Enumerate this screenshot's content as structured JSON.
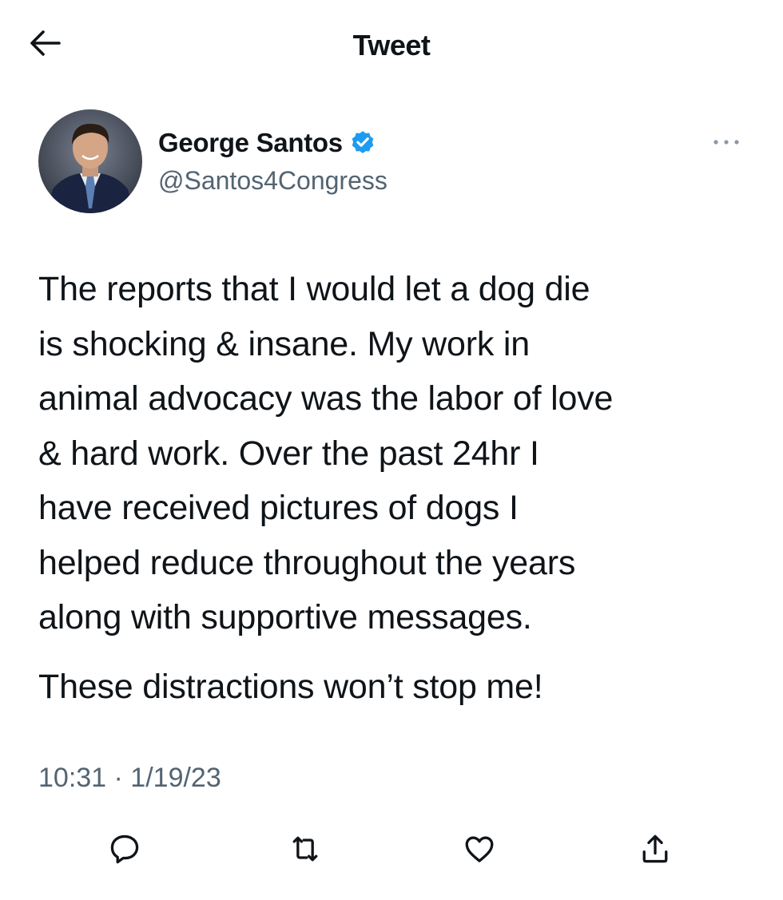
{
  "header": {
    "title": "Tweet",
    "back_icon": "arrow-left-icon"
  },
  "author": {
    "name": "George Santos",
    "handle": "@Santos4Congress",
    "verified": true,
    "verified_color": "#1d9bf0",
    "avatar_icon": "profile-photo"
  },
  "tweet": {
    "lines_para1": [
      "The reports that I would let a dog die",
      "is shocking & insane. My work in",
      "animal advocacy was the labor of love",
      "& hard work. Over the past 24hr I",
      "have received pictures of dogs I",
      "helped reduce throughout the years",
      "along with supportive messages."
    ],
    "para2": "These distractions won’t stop me!",
    "timestamp": "10:31 · 1/19/23"
  },
  "actions": {
    "reply_icon": "reply-icon",
    "retweet_icon": "retweet-icon",
    "like_icon": "heart-icon",
    "share_icon": "share-icon"
  },
  "colors": {
    "text": "#0f1419",
    "secondary": "#536471"
  }
}
